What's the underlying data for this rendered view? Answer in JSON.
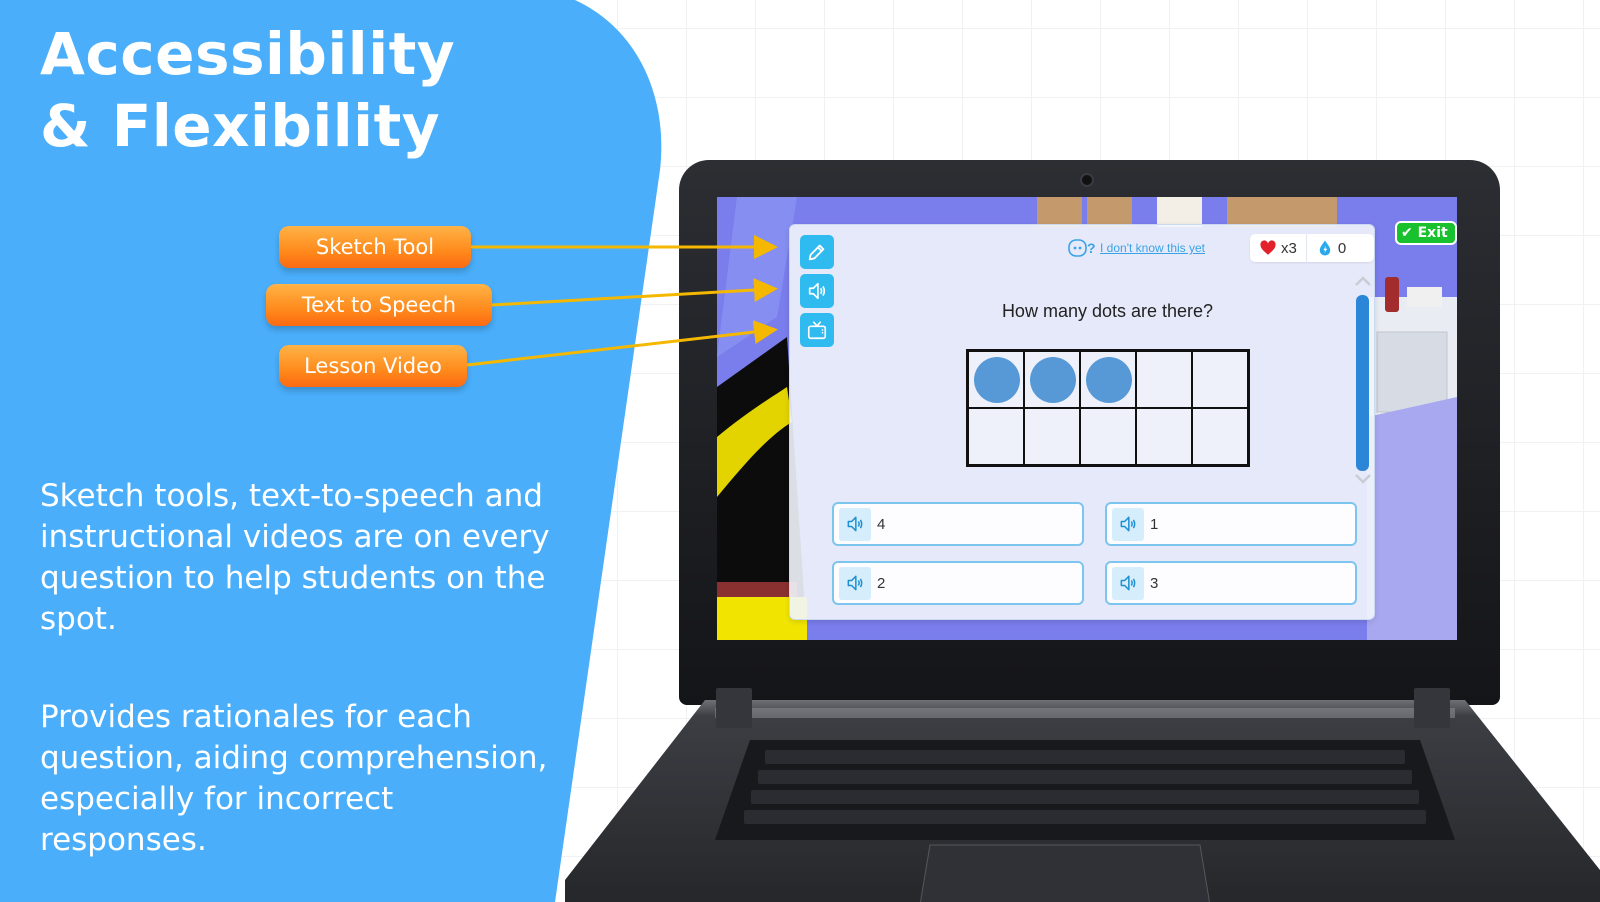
{
  "slide": {
    "title_line1": "Accessibility",
    "title_line2": "& Flexibility",
    "callouts": [
      {
        "label": "Sketch Tool"
      },
      {
        "label": "Text to Speech"
      },
      {
        "label": "Lesson Video"
      }
    ],
    "paragraph1": "Sketch tools, text-to-speech and instructional videos are on every question to help students on the spot.",
    "paragraph2": "Provides rationales for each question, aiding comprehension, especially for incorrect responses.",
    "colors": {
      "panel_blue": "#4aaefa",
      "callout_orange": "#ff8a1c",
      "arrow_yellow": "#f5b800"
    }
  },
  "game": {
    "exit_label": "✔ Exit",
    "tools": [
      {
        "icon": "pencil-icon",
        "label": "Sketch Tool"
      },
      {
        "icon": "speaker-icon",
        "label": "Text to Speech"
      },
      {
        "icon": "tv-icon",
        "label": "Lesson Video"
      }
    ],
    "idk_label": "I don't know this yet",
    "lives": "x3",
    "energy": "0",
    "question": "How many dots are there?",
    "ten_frame": {
      "filled": 3,
      "total": 10
    },
    "answers": [
      {
        "label": "4"
      },
      {
        "label": "1"
      },
      {
        "label": "2"
      },
      {
        "label": "3"
      }
    ],
    "colors": {
      "tool_blue": "#2fbaf0",
      "dot_blue": "#5699d6",
      "exit_green": "#19c12e",
      "scrollbar": "#2c86d8"
    }
  }
}
